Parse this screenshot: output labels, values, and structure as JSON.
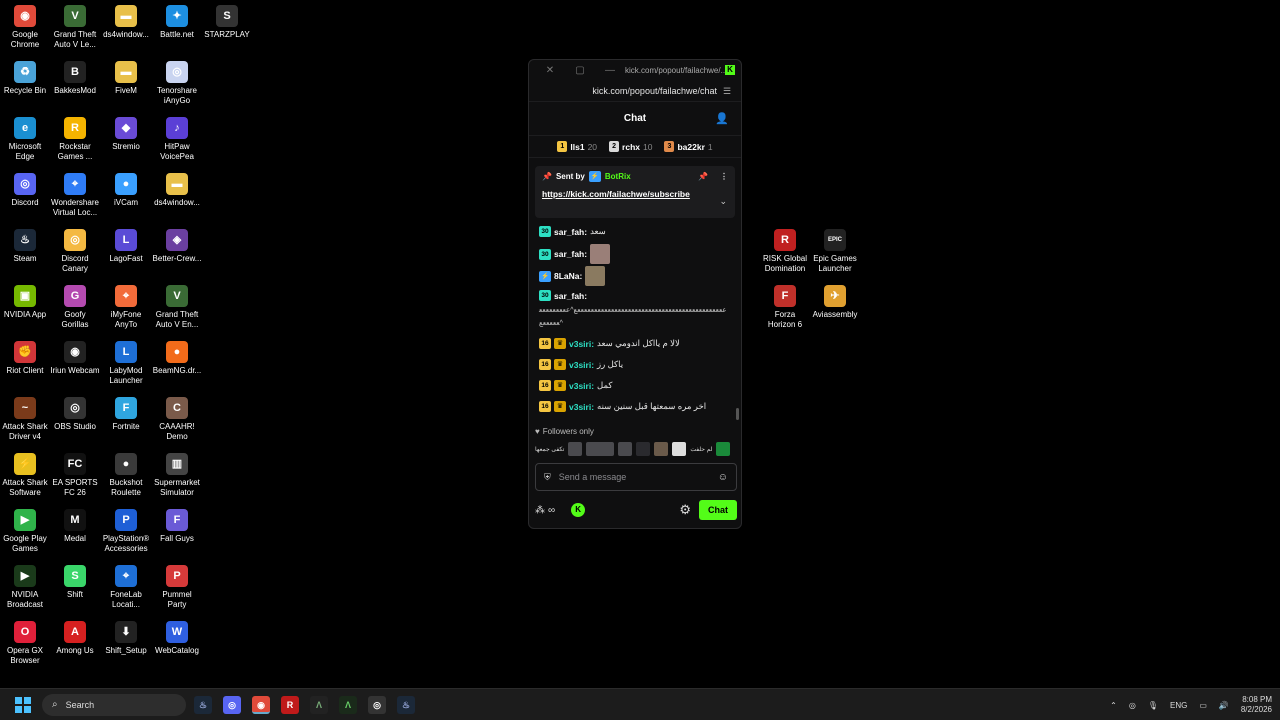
{
  "desktop": {
    "icons": [
      {
        "label": "Google Chrome",
        "color": "#e04a3a",
        "glyph": "◉"
      },
      {
        "label": "Grand Theft Auto V Le...",
        "color": "#3a6b35",
        "glyph": "V"
      },
      {
        "label": "ds4window...",
        "color": "#e8c04a",
        "glyph": "▬"
      },
      {
        "label": "Battle.net",
        "color": "#1d8fe1",
        "glyph": "✦"
      },
      {
        "label": "STARZPLAY",
        "color": "#333",
        "glyph": "S"
      },
      {
        "label": "Recycle Bin",
        "color": "#4aa3d8",
        "glyph": "♻"
      },
      {
        "label": "BakkesMod",
        "color": "#222",
        "glyph": "B"
      },
      {
        "label": "FiveM",
        "color": "#e8c04a",
        "glyph": "▬"
      },
      {
        "label": "Tenorshare iAnyGo",
        "color": "#c9d4f0",
        "glyph": "◎"
      },
      {
        "label": "Microsoft Edge",
        "color": "#1a8fd1",
        "glyph": "e"
      },
      {
        "label": "Rockstar Games ...",
        "color": "#f5b400",
        "glyph": "R"
      },
      {
        "label": "Stremio",
        "color": "#6a4bd6",
        "glyph": "◆"
      },
      {
        "label": "HitPaw VoicePea",
        "color": "#5b3fd6",
        "glyph": "♪"
      },
      {
        "label": "Discord",
        "color": "#5865f2",
        "glyph": "◎"
      },
      {
        "label": "Wondershare Virtual Loc...",
        "color": "#2f7cf6",
        "glyph": "⌖"
      },
      {
        "label": "iVCam",
        "color": "#3aa0ff",
        "glyph": "●"
      },
      {
        "label": "ds4window...",
        "color": "#e8c04a",
        "glyph": "▬"
      },
      {
        "label": "Steam",
        "color": "#1b2838",
        "glyph": "♨"
      },
      {
        "label": "Discord Canary",
        "color": "#f4b942",
        "glyph": "◎"
      },
      {
        "label": "LagoFast",
        "color": "#5a4bd6",
        "glyph": "L"
      },
      {
        "label": "Better-Crew...",
        "color": "#6b3fa0",
        "glyph": "◈"
      },
      {
        "label": "NVIDIA App",
        "color": "#76b900",
        "glyph": "▣"
      },
      {
        "label": "Goofy Gorillas",
        "color": "#b44ab0",
        "glyph": "G"
      },
      {
        "label": "iMyFone AnyTo",
        "color": "#f26b3a",
        "glyph": "⌖"
      },
      {
        "label": "Grand Theft Auto V En...",
        "color": "#3a6b35",
        "glyph": "V"
      },
      {
        "label": "Riot Client",
        "color": "#d13639",
        "glyph": "✊"
      },
      {
        "label": "Iriun Webcam",
        "color": "#222",
        "glyph": "◉"
      },
      {
        "label": "LabyMod Launcher",
        "color": "#1e6fd6",
        "glyph": "L"
      },
      {
        "label": "BeamNG.dr...",
        "color": "#f26b1a",
        "glyph": "●"
      },
      {
        "label": "Attack Shark Driver v4",
        "color": "#7a3a1a",
        "glyph": "~"
      },
      {
        "label": "OBS Studio",
        "color": "#333",
        "glyph": "◎"
      },
      {
        "label": "Fortnite",
        "color": "#2fa6e0",
        "glyph": "F"
      },
      {
        "label": "CAAAHR! Demo",
        "color": "#7a5a4a",
        "glyph": "C"
      },
      {
        "label": "Attack Shark Software",
        "color": "#e8c020",
        "glyph": "⚡"
      },
      {
        "label": "EA SPORTS FC 26",
        "color": "#111",
        "glyph": "FC"
      },
      {
        "label": "Buckshot Roulette",
        "color": "#3a3a3a",
        "glyph": "●"
      },
      {
        "label": "Supermarket Simulator",
        "color": "#444",
        "glyph": "▥"
      },
      {
        "label": "Google Play Games",
        "color": "#2fb34a",
        "glyph": "▶"
      },
      {
        "label": "Medal",
        "color": "#111",
        "glyph": "M"
      },
      {
        "label": "PlayStation® Accessories",
        "color": "#1e5fd6",
        "glyph": "P"
      },
      {
        "label": "Fall Guys",
        "color": "#6a5ad6",
        "glyph": "F"
      },
      {
        "label": "NVIDIA Broadcast",
        "color": "#1a3a1a",
        "glyph": "▶"
      },
      {
        "label": "Shift",
        "color": "#3ad66a",
        "glyph": "S"
      },
      {
        "label": "FoneLab Locati...",
        "color": "#1e6fd6",
        "glyph": "⌖"
      },
      {
        "label": "Pummel Party",
        "color": "#d63a3a",
        "glyph": "P"
      },
      {
        "label": "Opera GX Browser",
        "color": "#e0203a",
        "glyph": "O"
      },
      {
        "label": "Among Us",
        "color": "#d62020",
        "glyph": "A"
      },
      {
        "label": "Shift_Setup",
        "color": "#222",
        "glyph": "⬇"
      },
      {
        "label": "WebCatalog",
        "color": "#2f5fe0",
        "glyph": "W"
      },
      {
        "label": "RISK Global Domination",
        "color": "#c02020",
        "glyph": "R"
      },
      {
        "label": "Epic Games Launcher",
        "color": "#222",
        "glyph": "EPIC"
      },
      {
        "label": "Forza Horizon 6",
        "color": "#c0302a",
        "glyph": "F"
      },
      {
        "label": "Aviassembly",
        "color": "#e0a030",
        "glyph": "✈"
      }
    ]
  },
  "popout": {
    "title": "kick.com/popout/failachwe/...",
    "url": "kick.com/popout/failachwe/chat",
    "header": "Chat",
    "leaderboard": [
      {
        "rank": "1",
        "name": "lls1",
        "count": "20",
        "color": "#f4c542"
      },
      {
        "rank": "2",
        "name": "rchx",
        "count": "10",
        "color": "#d9d9d9"
      },
      {
        "rank": "3",
        "name": "ba22kr",
        "count": "1",
        "color": "#e08a4a"
      }
    ],
    "pinned": {
      "sent_by": "Sent by",
      "bot": "BotRix",
      "link": "https://kick.com/failachwe/subscribe"
    },
    "messages": {
      "m1": {
        "badge": "30",
        "user": "sar_fah:",
        "text": "سعد"
      },
      "m2": {
        "badge": "30",
        "user": "sar_fah:",
        "text": ""
      },
      "m3": {
        "badge": "",
        "user": "8LaNa:",
        "text": ""
      },
      "m4": {
        "badge": "30",
        "user": "sar_fah:",
        "text": ""
      },
      "long": "ععععععععععععععععععععععععععععععععععععععععععععع^ععععععععععععععع^",
      "m5": {
        "badge": "16",
        "user": "v3siri:",
        "text": "لالا م يااكل اندومي سعد"
      },
      "m6": {
        "badge": "16",
        "user": "v3siri:",
        "text": "ياكل رز"
      },
      "m7": {
        "badge": "16",
        "user": "v3siri:",
        "text": "كمل"
      },
      "m8": {
        "badge": "16",
        "user": "v3siri:",
        "text": "اخر مره سمعتها قبل سنين سنه"
      }
    },
    "followers_only": "Followers only",
    "emote_text1": "تكفى جمعها",
    "emote_text2": "لم حلفت",
    "input_placeholder": "Send a message",
    "chat_button": "Chat",
    "points": "∞"
  },
  "taskbar": {
    "search": "Search",
    "lang": "ENG",
    "time": "8:08 PM",
    "date": "8/2/2026"
  }
}
